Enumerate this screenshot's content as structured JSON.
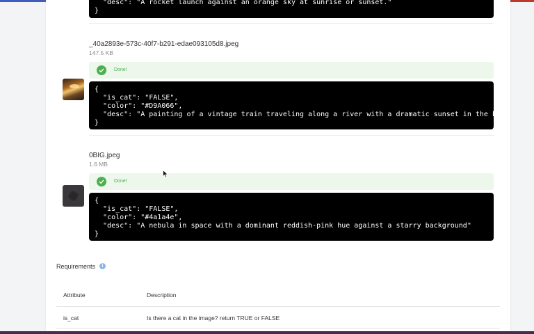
{
  "files": [
    {
      "code_tail": "  \"desc\": \"A rocket launch against an orange sky at sunrise or sunset.\"\n}"
    },
    {
      "name": "_40a2893e-573c-40f7-b291-edae093105d8.jpeg",
      "size": "147.5 KB",
      "status": "Done!",
      "code": "{\n  \"is_cat\": \"FALSE\",\n  \"color\": \"#D9A066\",\n  \"desc\": \"A painting of a vintage train traveling along a river with a dramatic sunset in the background.\"\n}",
      "thumb_icon": "train-sunset-thumbnail"
    },
    {
      "name": "0BIG.jpeg",
      "size": "1.6 MB",
      "status": "Done!",
      "code": "{\n  \"is_cat\": \"FALSE\",\n  \"color\": \"#4a1a4e\",\n  \"desc\": \"A nebula in space with a dominant reddish-pink hue against a starry background\"\n}",
      "thumb_icon": "nebula-thumbnail"
    }
  ],
  "requirements": {
    "title": "Requirements",
    "info_icon": "info-icon",
    "headers": {
      "attribute": "Attribute",
      "description": "Description"
    },
    "rows": [
      {
        "attribute": "is_cat",
        "description": "Is there a cat in the image? return TRUE or FALSE"
      }
    ]
  },
  "colors": {
    "status_bg": "#edf7ec",
    "status_green": "#4caf50",
    "code_bg": "#000000",
    "info_blue": "#8ab7e8"
  }
}
